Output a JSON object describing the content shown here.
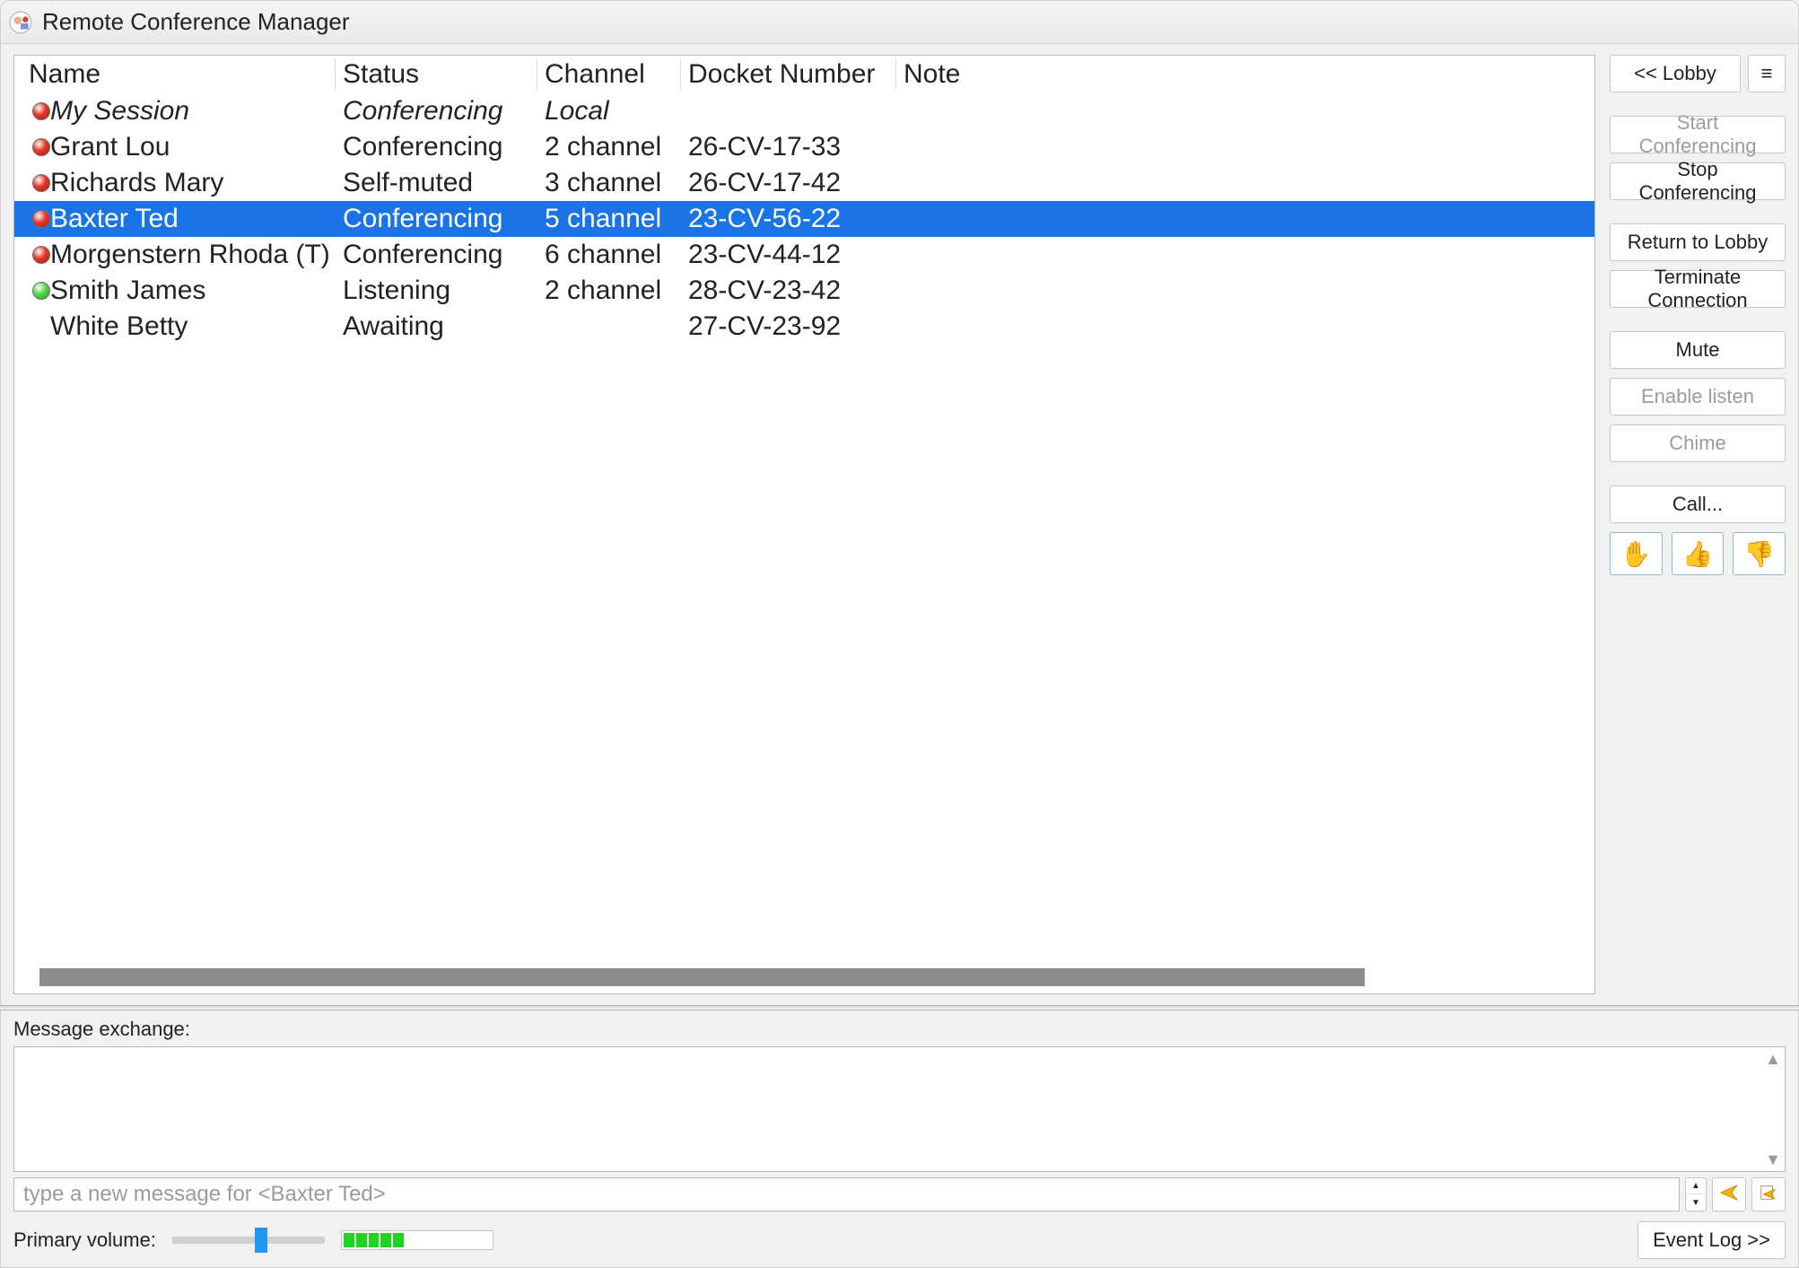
{
  "window": {
    "title": "Remote Conference Manager"
  },
  "columns": {
    "name": "Name",
    "status": "Status",
    "channel": "Channel",
    "docket": "Docket Number",
    "note": "Note"
  },
  "participants": [
    {
      "dot": "red",
      "italic": true,
      "selected": false,
      "name": "My Session",
      "status": "Conferencing",
      "channel": "Local",
      "docket": "",
      "note": ""
    },
    {
      "dot": "red",
      "italic": false,
      "selected": false,
      "name": "Grant Lou",
      "status": "Conferencing",
      "channel": "2 channel",
      "docket": "26-CV-17-33",
      "note": ""
    },
    {
      "dot": "red",
      "italic": false,
      "selected": false,
      "name": "Richards Mary",
      "status": "Self-muted",
      "channel": "3 channel",
      "docket": "26-CV-17-42",
      "note": ""
    },
    {
      "dot": "red",
      "italic": false,
      "selected": true,
      "name": "Baxter Ted",
      "status": "Conferencing",
      "channel": "5 channel",
      "docket": "23-CV-56-22",
      "note": ""
    },
    {
      "dot": "red",
      "italic": false,
      "selected": false,
      "name": "Morgenstern Rhoda (T)",
      "status": "Conferencing",
      "channel": "6 channel",
      "docket": "23-CV-44-12",
      "note": ""
    },
    {
      "dot": "green",
      "italic": false,
      "selected": false,
      "name": "Smith James",
      "status": "Listening",
      "channel": "2 channel",
      "docket": "28-CV-23-42",
      "note": ""
    },
    {
      "dot": "none",
      "italic": false,
      "selected": false,
      "name": "White Betty",
      "status": "Awaiting",
      "channel": "",
      "docket": "27-CV-23-92",
      "note": ""
    }
  ],
  "side": {
    "lobby": "<< Lobby",
    "menu_icon": "≡",
    "start_conferencing": "Start Conferencing",
    "stop_conferencing": "Stop Conferencing",
    "return_to_lobby": "Return to Lobby",
    "terminate_connection": "Terminate Connection",
    "mute": "Mute",
    "enable_listen": "Enable listen",
    "chime": "Chime",
    "call": "Call...",
    "gestures": {
      "raise_hand": "✋",
      "thumbs_up": "👍",
      "thumbs_down": "👎"
    },
    "disabled": {
      "start_conferencing": true,
      "enable_listen": true,
      "chime": true
    }
  },
  "bottom": {
    "message_exchange_label": "Message exchange:",
    "compose_placeholder": "type a new message for <Baxter Ted>",
    "primary_volume_label": "Primary volume:",
    "event_log": "Event Log >>",
    "volume_percent": 55,
    "meter_active_segments": 5,
    "meter_total_segments": 12
  }
}
